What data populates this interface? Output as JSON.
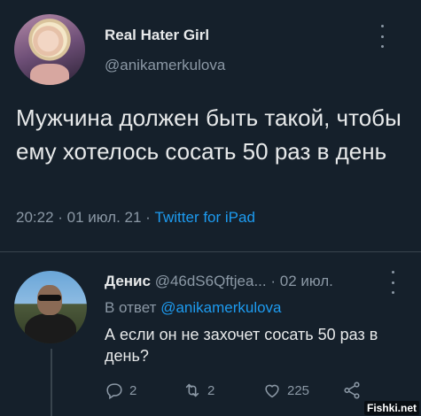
{
  "main_tweet": {
    "author_name": "Real Hater Girl",
    "author_handle": "@anikamerkulova",
    "text": "Мужчина должен быть такой, чтобы ему хотелось сосать 50 раз в день",
    "time": "20:22",
    "separator": " · ",
    "date": "01 июл. 21",
    "source": "Twitter for iPad"
  },
  "reply": {
    "author_name": "Денис",
    "author_handle": "@46dS6Qftjea...",
    "date": "· 02 июл.",
    "reply_to_label": "В ответ",
    "reply_to_handle": "@anikamerkulova",
    "text": "А если он не захочет сосать 50 раз в день?",
    "actions": {
      "replies": "2",
      "retweets": "2",
      "likes": "225"
    }
  },
  "watermark": "Fishki.net",
  "colors": {
    "background": "#15202b",
    "text": "#e7e9ea",
    "secondary": "#8b98a5",
    "link": "#1d9bf0",
    "divider": "#38444d"
  },
  "icons": [
    "more-icon",
    "reply-icon",
    "retweet-icon",
    "like-icon",
    "share-icon"
  ]
}
